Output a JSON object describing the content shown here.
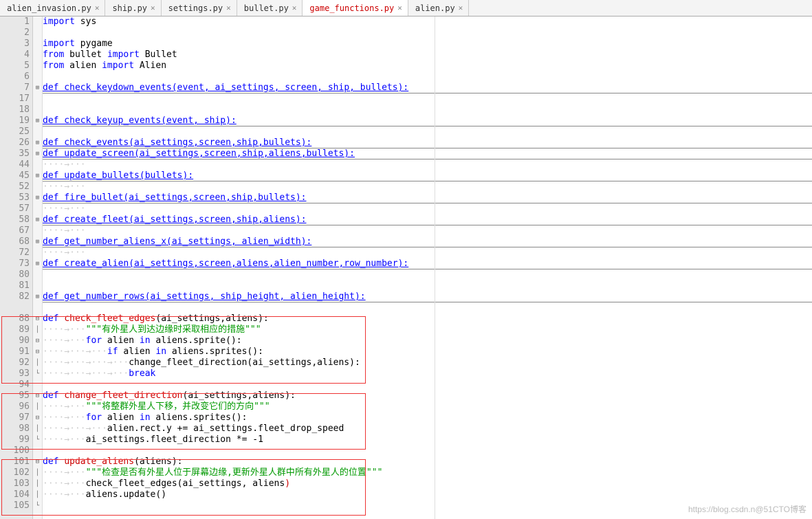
{
  "tabs": [
    {
      "label": "alien_invasion.py",
      "active": false
    },
    {
      "label": "ship.py",
      "active": false
    },
    {
      "label": "settings.py",
      "active": false
    },
    {
      "label": "bullet.py",
      "active": false
    },
    {
      "label": "game_functions.py",
      "active": true
    },
    {
      "label": "alien.py",
      "active": false
    }
  ],
  "lines": [
    {
      "n": 1,
      "f": "",
      "seg": [
        [
          "kw-blue",
          "import"
        ],
        [
          "txt",
          " sys"
        ]
      ]
    },
    {
      "n": 2,
      "f": "",
      "seg": []
    },
    {
      "n": 3,
      "f": "",
      "seg": [
        [
          "kw-blue",
          "import"
        ],
        [
          "txt",
          " pygame"
        ]
      ]
    },
    {
      "n": 4,
      "f": "",
      "seg": [
        [
          "kw-blue",
          "from"
        ],
        [
          "txt",
          " bullet "
        ],
        [
          "kw-blue",
          "import"
        ],
        [
          "txt",
          " Bullet"
        ]
      ]
    },
    {
      "n": 5,
      "f": "",
      "seg": [
        [
          "kw-blue",
          "from"
        ],
        [
          "txt",
          " alien "
        ],
        [
          "kw-blue",
          "import"
        ],
        [
          "txt",
          " Alien"
        ]
      ]
    },
    {
      "n": 6,
      "f": "",
      "seg": []
    },
    {
      "n": 7,
      "f": "⊞",
      "seg": [
        [
          "def-line",
          "def"
        ],
        [
          "func-blue",
          " check_keydown_events"
        ],
        [
          "def-line",
          "(event, ai_settings, screen, ship, bullets):"
        ]
      ],
      "hr": true
    },
    {
      "n": 17,
      "f": "",
      "seg": []
    },
    {
      "n": 18,
      "f": "",
      "seg": []
    },
    {
      "n": 19,
      "f": "⊞",
      "seg": [
        [
          "def-line",
          "def"
        ],
        [
          "func-blue",
          " check_keyup_events"
        ],
        [
          "def-line",
          "(event, ship):"
        ]
      ],
      "hr": true
    },
    {
      "n": 25,
      "f": "",
      "seg": []
    },
    {
      "n": 26,
      "f": "⊞",
      "seg": [
        [
          "def-line",
          "def"
        ],
        [
          "func-blue",
          " check_events"
        ],
        [
          "def-line",
          "(ai_settings,screen,ship,bullets):"
        ]
      ],
      "hr": true
    },
    {
      "n": 35,
      "f": "⊞",
      "seg": [
        [
          "def-line",
          "def"
        ],
        [
          "func-blue",
          " update_screen"
        ],
        [
          "def-line",
          "(ai_settings,screen,ship,aliens,bullets):"
        ]
      ],
      "hr": true
    },
    {
      "n": 44,
      "f": "",
      "seg": [
        [
          "arrow",
          "····→···"
        ]
      ]
    },
    {
      "n": 45,
      "f": "⊞",
      "seg": [
        [
          "def-line",
          "def"
        ],
        [
          "func-blue",
          " update_bullets"
        ],
        [
          "def-line",
          "(bullets):"
        ]
      ],
      "hr": true
    },
    {
      "n": 52,
      "f": "",
      "seg": [
        [
          "arrow",
          "····→···"
        ]
      ]
    },
    {
      "n": 53,
      "f": "⊞",
      "seg": [
        [
          "def-line",
          "def"
        ],
        [
          "func-blue",
          " fire_bullet"
        ],
        [
          "def-line",
          "(ai_settings,screen,ship,bullets):"
        ]
      ],
      "hr": true
    },
    {
      "n": 57,
      "f": "",
      "seg": [
        [
          "arrow",
          "····→···"
        ]
      ]
    },
    {
      "n": 58,
      "f": "⊞",
      "seg": [
        [
          "def-line",
          "def"
        ],
        [
          "func-blue",
          " create_fleet"
        ],
        [
          "def-line",
          "(ai_settings,screen,ship,aliens):"
        ]
      ],
      "hr": true
    },
    {
      "n": 67,
      "f": "",
      "seg": [
        [
          "arrow",
          "····→···"
        ]
      ]
    },
    {
      "n": 68,
      "f": "⊞",
      "seg": [
        [
          "def-line",
          "def"
        ],
        [
          "func-blue",
          " get_number_aliens_x"
        ],
        [
          "def-line",
          "(ai_settings, alien_width):"
        ]
      ],
      "hr": true
    },
    {
      "n": 72,
      "f": "",
      "seg": [
        [
          "arrow",
          "····→···"
        ]
      ]
    },
    {
      "n": 73,
      "f": "⊞",
      "seg": [
        [
          "def-line",
          "def"
        ],
        [
          "func-blue",
          " create_alien"
        ],
        [
          "def-line",
          "(ai_settings,screen,aliens,alien_number,row_number):"
        ]
      ],
      "hr": true
    },
    {
      "n": 80,
      "f": "",
      "seg": []
    },
    {
      "n": 81,
      "f": "",
      "seg": []
    },
    {
      "n": 82,
      "f": "⊞",
      "seg": [
        [
          "def-line",
          "def"
        ],
        [
          "func-blue",
          " get_number_rows"
        ],
        [
          "def-line",
          "(ai_settings, ship_height, alien_height):"
        ]
      ],
      "hr": true
    },
    {
      "n": "",
      "f": "",
      "seg": []
    },
    {
      "n": 88,
      "f": "⊟",
      "seg": [
        [
          "kw-blue",
          "def"
        ],
        [
          "txt",
          " "
        ],
        [
          "kw-red",
          "check_fleet_edges"
        ],
        [
          "txt",
          "(ai_settings,aliens):"
        ]
      ]
    },
    {
      "n": 89,
      "f": "│",
      "seg": [
        [
          "arrow",
          "····→···"
        ],
        [
          "str-green",
          "\"\"\"有外星人到达边缘时采取相应的措施\"\"\""
        ]
      ]
    },
    {
      "n": 90,
      "f": "⊟",
      "seg": [
        [
          "arrow",
          "····→···"
        ],
        [
          "kw-blue",
          "for"
        ],
        [
          "txt",
          " alien "
        ],
        [
          "kw-blue",
          "in"
        ],
        [
          "txt",
          " aliens.sprite():"
        ]
      ]
    },
    {
      "n": 91,
      "f": "⊟",
      "seg": [
        [
          "arrow",
          "····→···→···"
        ],
        [
          "kw-blue",
          "if"
        ],
        [
          "txt",
          " alien "
        ],
        [
          "kw-blue",
          "in"
        ],
        [
          "txt",
          " aliens.sprites():"
        ]
      ]
    },
    {
      "n": 92,
      "f": "│",
      "seg": [
        [
          "arrow",
          "····→···→···→···"
        ],
        [
          "txt",
          "change_fleet_direction(ai_settings,aliens):"
        ]
      ]
    },
    {
      "n": 93,
      "f": "└",
      "seg": [
        [
          "arrow",
          "····→···→···→···"
        ],
        [
          "kw-blue",
          "break"
        ]
      ]
    },
    {
      "n": 94,
      "f": "",
      "seg": []
    },
    {
      "n": 95,
      "f": "⊟",
      "seg": [
        [
          "kw-blue",
          "def"
        ],
        [
          "txt",
          " "
        ],
        [
          "kw-red",
          "change_fleet_direction"
        ],
        [
          "txt",
          "(ai_settings,aliens):"
        ]
      ]
    },
    {
      "n": 96,
      "f": "│",
      "seg": [
        [
          "arrow",
          "····→···"
        ],
        [
          "str-green",
          "\"\"\"将整群外星人下移，并改变它们的方向\"\"\""
        ]
      ]
    },
    {
      "n": 97,
      "f": "⊟",
      "seg": [
        [
          "arrow",
          "····→···"
        ],
        [
          "kw-blue",
          "for"
        ],
        [
          "txt",
          " alien "
        ],
        [
          "kw-blue",
          "in"
        ],
        [
          "txt",
          " aliens.sprites():"
        ]
      ]
    },
    {
      "n": 98,
      "f": "│",
      "seg": [
        [
          "arrow",
          "····→···→···"
        ],
        [
          "txt",
          "alien.rect.y += ai_settings.fleet_drop_speed"
        ]
      ]
    },
    {
      "n": 99,
      "f": "└",
      "seg": [
        [
          "arrow",
          "····→···"
        ],
        [
          "txt",
          "ai_settings.fleet_direction *= -1"
        ]
      ]
    },
    {
      "n": 100,
      "f": "",
      "seg": []
    },
    {
      "n": 101,
      "f": "⊟",
      "seg": [
        [
          "kw-blue",
          "def"
        ],
        [
          "txt",
          " "
        ],
        [
          "kw-red",
          "update_aliens"
        ],
        [
          "txt",
          "(aliens):"
        ]
      ]
    },
    {
      "n": 102,
      "f": "│",
      "seg": [
        [
          "arrow",
          "····→···"
        ],
        [
          "str-green",
          "\"\"\"检查是否有外星人位于屏幕边缘,更新外星人群中所有外星人的位置\"\"\""
        ]
      ]
    },
    {
      "n": 103,
      "f": "│",
      "seg": [
        [
          "arrow",
          "····→···"
        ],
        [
          "txt",
          "check_fleet_edges(ai_settings, aliens"
        ],
        [
          "kw-red",
          ")"
        ]
      ]
    },
    {
      "n": 104,
      "f": "│",
      "seg": [
        [
          "arrow",
          "····→···"
        ],
        [
          "txt",
          "aliens.update()"
        ]
      ]
    },
    {
      "n": 105,
      "f": "└",
      "seg": []
    }
  ],
  "watermark": "https://blog.csdn.n@51CTO博客"
}
